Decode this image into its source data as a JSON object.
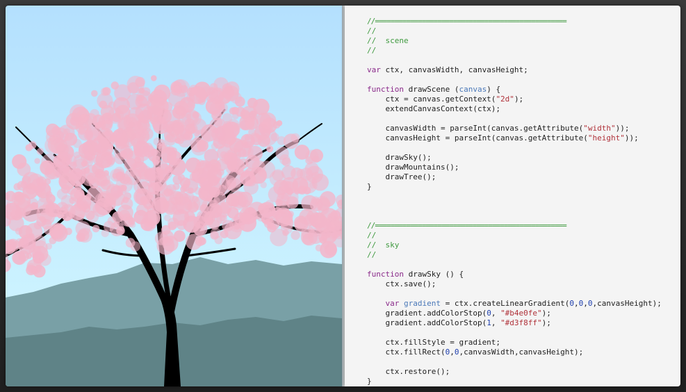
{
  "colors": {
    "sky_top": "#b4e0fe",
    "sky_bottom": "#d3f8ff",
    "mountain_back": "#79a0a6",
    "mountain_front": "#5f8387",
    "trunk": "#000000",
    "blossom": "#f3b6ca",
    "code_background": "#f4f4f4",
    "comment": "#3f9a3f",
    "keyword": "#8a2a8a",
    "string": "#b0323a",
    "number": "#1e3fae",
    "parameter": "#4a78b8"
  },
  "code": {
    "lines": [
      [
        {
          "t": "//=================================================",
          "c": "rule"
        }
      ],
      [
        {
          "t": "//",
          "c": "cm"
        }
      ],
      [
        {
          "t": "//  scene",
          "c": "cm"
        }
      ],
      [
        {
          "t": "//",
          "c": "cm"
        }
      ],
      [],
      [
        {
          "t": "var",
          "c": "kw"
        },
        {
          "t": " ctx, canvasWidth, canvasHeight;",
          "c": ""
        }
      ],
      [],
      [
        {
          "t": "function",
          "c": "kw"
        },
        {
          "t": " drawScene (",
          "c": ""
        },
        {
          "t": "canvas",
          "c": "par"
        },
        {
          "t": ") {",
          "c": ""
        }
      ],
      [
        {
          "t": "    ctx = canvas.getContext(",
          "c": ""
        },
        {
          "t": "\"2d\"",
          "c": "str"
        },
        {
          "t": ");",
          "c": ""
        }
      ],
      [
        {
          "t": "    extendCanvasContext(ctx);",
          "c": ""
        }
      ],
      [],
      [
        {
          "t": "    canvasWidth = parseInt(canvas.getAttribute(",
          "c": ""
        },
        {
          "t": "\"width\"",
          "c": "str"
        },
        {
          "t": "));",
          "c": ""
        }
      ],
      [
        {
          "t": "    canvasHeight = parseInt(canvas.getAttribute(",
          "c": ""
        },
        {
          "t": "\"height\"",
          "c": "str"
        },
        {
          "t": "));",
          "c": ""
        }
      ],
      [],
      [
        {
          "t": "    drawSky();",
          "c": ""
        }
      ],
      [
        {
          "t": "    drawMountains();",
          "c": ""
        }
      ],
      [
        {
          "t": "    drawTree();",
          "c": ""
        }
      ],
      [
        {
          "t": "}",
          "c": ""
        }
      ],
      [],
      [],
      [],
      [
        {
          "t": "//=================================================",
          "c": "rule"
        }
      ],
      [
        {
          "t": "//",
          "c": "cm"
        }
      ],
      [
        {
          "t": "//  sky",
          "c": "cm"
        }
      ],
      [
        {
          "t": "//",
          "c": "cm"
        }
      ],
      [],
      [
        {
          "t": "function",
          "c": "kw"
        },
        {
          "t": " drawSky () {",
          "c": ""
        }
      ],
      [
        {
          "t": "    ctx.save();",
          "c": ""
        }
      ],
      [],
      [
        {
          "t": "    ",
          "c": ""
        },
        {
          "t": "var",
          "c": "kw"
        },
        {
          "t": " ",
          "c": ""
        },
        {
          "t": "gradient",
          "c": "par"
        },
        {
          "t": " = ctx.createLinearGradient(",
          "c": ""
        },
        {
          "t": "0",
          "c": "num"
        },
        {
          "t": ",",
          "c": ""
        },
        {
          "t": "0",
          "c": "num"
        },
        {
          "t": ",",
          "c": ""
        },
        {
          "t": "0",
          "c": "num"
        },
        {
          "t": ",canvasHeight);",
          "c": ""
        }
      ],
      [
        {
          "t": "    gradient.addColorStop(",
          "c": ""
        },
        {
          "t": "0",
          "c": "num"
        },
        {
          "t": ", ",
          "c": ""
        },
        {
          "t": "\"#b4e0fe\"",
          "c": "str"
        },
        {
          "t": ");",
          "c": ""
        }
      ],
      [
        {
          "t": "    gradient.addColorStop(",
          "c": ""
        },
        {
          "t": "1",
          "c": "num"
        },
        {
          "t": ", ",
          "c": ""
        },
        {
          "t": "\"#d3f8ff\"",
          "c": "str"
        },
        {
          "t": ");",
          "c": ""
        }
      ],
      [],
      [
        {
          "t": "    ctx.fillStyle = gradient;",
          "c": ""
        }
      ],
      [
        {
          "t": "    ctx.fillRect(",
          "c": ""
        },
        {
          "t": "0",
          "c": "num"
        },
        {
          "t": ",",
          "c": ""
        },
        {
          "t": "0",
          "c": "num"
        },
        {
          "t": ",canvasWidth,canvasHeight);",
          "c": ""
        }
      ],
      [],
      [
        {
          "t": "    ctx.restore();",
          "c": ""
        }
      ],
      [
        {
          "t": "}",
          "c": ""
        }
      ]
    ]
  }
}
